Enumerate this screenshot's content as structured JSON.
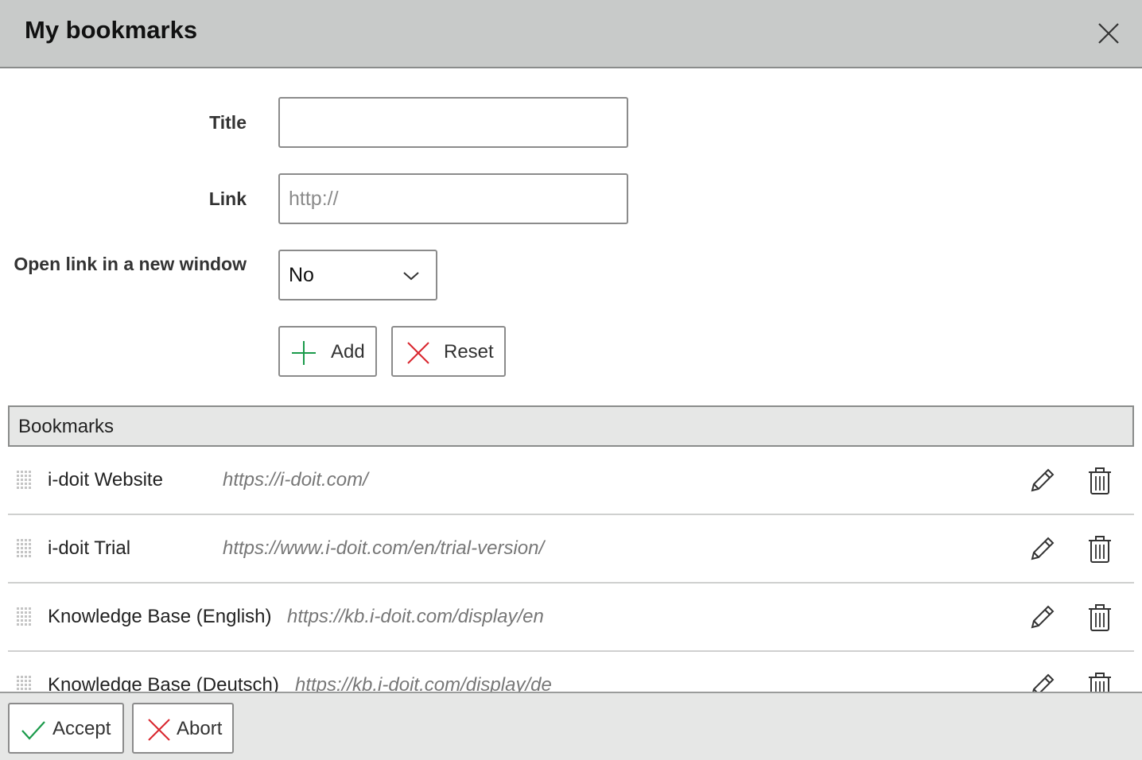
{
  "dialog": {
    "title": "My bookmarks"
  },
  "form": {
    "title_label": "Title",
    "title_value": "",
    "link_label": "Link",
    "link_placeholder": "http://",
    "new_window_label": "Open link in a new window",
    "new_window_value": "No",
    "add_label": "Add",
    "reset_label": "Reset"
  },
  "bookmarks": {
    "header": "Bookmarks",
    "items": [
      {
        "name": "i-doit Website",
        "url": "https://i-doit.com/"
      },
      {
        "name": "i-doit Trial",
        "url": "https://www.i-doit.com/en/trial-version/"
      },
      {
        "name": "Knowledge Base (English)",
        "url": "https://kb.i-doit.com/display/en"
      },
      {
        "name": "Knowledge Base (Deutsch)",
        "url": "https://kb.i-doit.com/display/de"
      }
    ]
  },
  "footer": {
    "accept_label": "Accept",
    "abort_label": "Abort"
  },
  "colors": {
    "header_bg": "#c8cac9",
    "add_icon": "#1a9a4a",
    "reset_icon": "#d9262e",
    "accept_icon": "#1a9a4a",
    "abort_icon": "#d9262e"
  },
  "icons": {
    "close": "close-icon",
    "add": "plus-icon",
    "reset": "x-icon",
    "select": "chevron-down-icon",
    "grip": "drag-handle-icon",
    "edit": "pencil-icon",
    "delete": "trash-icon",
    "accept": "checkmark-icon",
    "abort": "x-icon"
  }
}
